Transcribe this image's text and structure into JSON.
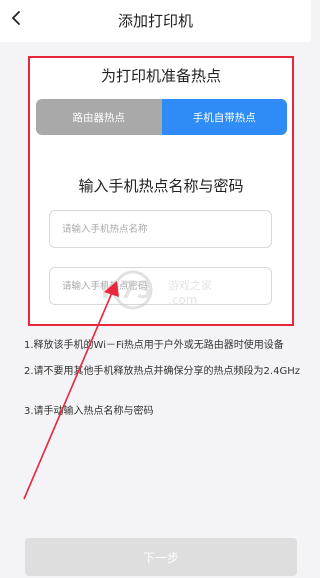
{
  "header": {
    "back_icon": "chevron-left-icon",
    "title": "添加打印机"
  },
  "card": {
    "title": "为打印机准备热点",
    "tabs": [
      {
        "label": "路由器热点",
        "selected": false
      },
      {
        "label": "手机自带热点",
        "selected": true
      }
    ],
    "section_title": "输入手机热点名称与密码",
    "ssid_placeholder": "请输入手机热点名称",
    "password_placeholder": "请输入手机热点密码",
    "highlight_color": "#e8263c"
  },
  "notes": [
    "1.释放该手机的Wi－Fi热点用于户外或无路由器时使用设备",
    "2.请不要用其他手机释放热点并确保分享的热点频段为2.4GHz",
    "3.请手动输入热点名称与密码"
  ],
  "footer": {
    "next_label": "下一步"
  },
  "colors": {
    "accent": "#2f8cf6",
    "inactive_tab": "#a9a9a9",
    "annotation": "#e8263c",
    "disabled_button": "#dedede"
  }
}
